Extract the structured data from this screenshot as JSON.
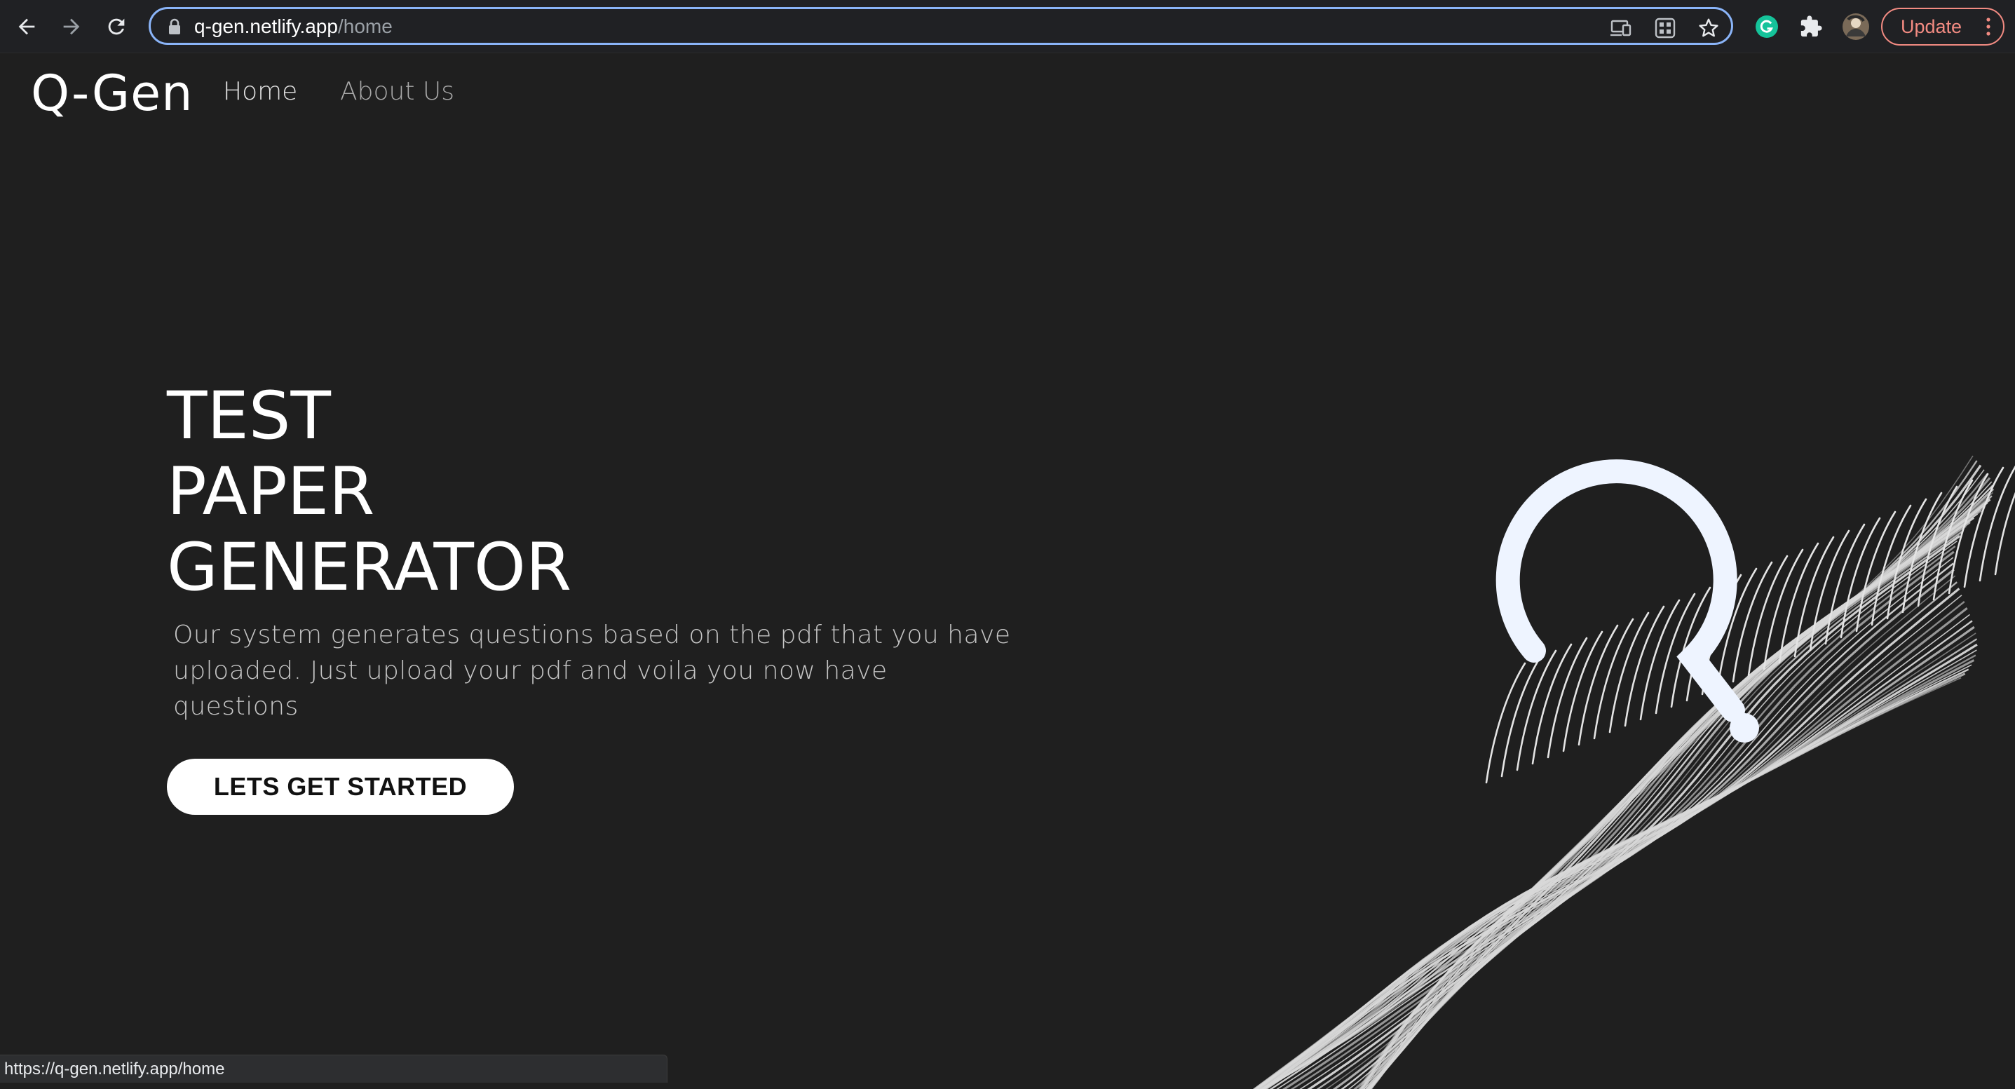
{
  "browser": {
    "url_host": "q-gen.netlify.app",
    "url_path": "/home",
    "update_label": "Update",
    "status_url": "https://q-gen.netlify.app/home",
    "icons": [
      "back-arrow-icon",
      "forward-arrow-icon",
      "reload-icon",
      "lock-icon",
      "cast-icon",
      "qr-code-icon",
      "star-icon",
      "grammarly-icon",
      "extensions-icon",
      "profile-avatar",
      "menu-dots-icon"
    ]
  },
  "site": {
    "brand": "Q-Gen",
    "nav": [
      {
        "label": "Home",
        "active": true
      },
      {
        "label": "About Us",
        "active": false
      }
    ]
  },
  "hero": {
    "title_lines": [
      "TEST",
      "PAPER",
      "GENERATOR"
    ],
    "description": "Our system generates questions based on the pdf that you have uploaded. Just upload your pdf and voila you now have questions",
    "cta_label": "LETS GET STARTED"
  },
  "colors": {
    "page_bg": "#1f1f1f",
    "browser_bar": "#202124",
    "omnibox_border": "#8ab4f8",
    "update_accent": "#f28b82",
    "question_mark": "#eef4ff"
  }
}
